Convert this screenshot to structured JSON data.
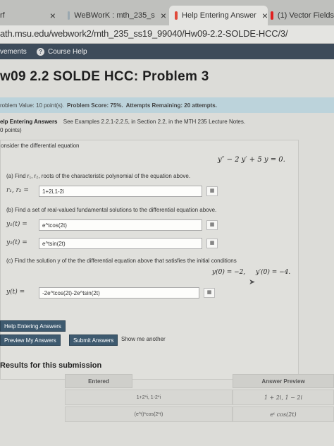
{
  "browser": {
    "tabs": [
      {
        "label": "rf",
        "close": "×"
      },
      {
        "label": "WeBWorK : mth_235_s",
        "close": "×"
      },
      {
        "label": "Help Entering Answer",
        "close": "×"
      },
      {
        "label": "(1) Vector Fields"
      }
    ],
    "url": "ath.msu.edu/webwork2/mth_235_ss19_99040/Hw09-2.2-SOLDE-HCC/3/"
  },
  "nav": {
    "items": [
      "vements",
      "Course Help"
    ]
  },
  "page": {
    "title": "w09 2.2 SOLDE HCC: Problem 3",
    "info": {
      "problem_value": "roblem Value: 10 point(s).",
      "problem_score": "Problem Score: 75%.",
      "attempts": "Attempts Remaining: 20 attempts."
    },
    "help_heading": "elp Entering Answers",
    "help_text": "See Examples 2.2.1-2.2.5, in Section 2.2, in the MTH 235 Lecture Notes.",
    "points": "0 points)"
  },
  "problem": {
    "intro": "onsider the differential equation",
    "equation": "y″ − 2 y′ + 5 y = 0.",
    "part_a": "(a) Find r₁, r₂, roots of the characteristic polynomial of the equation above.",
    "part_a_label": "r₁, r₂ =",
    "part_a_value": "1+2i,1-2i",
    "part_b": "(b) Find a set of real-valued fundamental solutions to the differential equation above.",
    "y1_label": "y₁(t) =",
    "y1_value": "e^tcos(2t)",
    "y2_label": "y₂(t) =",
    "y2_value": "e^tsin(2t)",
    "part_c": "(c) Find the solution y of the the differential equation above that satisfies the initial conditions",
    "ic1": "y(0) = −2,",
    "ic2": "y′(0) = −4.",
    "yt_label": "y(t) =",
    "yt_value": "-2e^tcos(2t)-2e^tsin(2t)",
    "grid_icon": "▦"
  },
  "buttons": {
    "help_entering": "Help Entering Answers",
    "preview": "Preview My Answers",
    "submit": "Submit Answers",
    "show_me": "Show me another"
  },
  "results": {
    "title": "Results for this submission",
    "headers": [
      "Entered",
      "Answer Preview"
    ],
    "rows": [
      [
        "1+2*i, 1-2*i",
        "1 + 2i, 1 − 2i"
      ],
      [
        "(e^t)*cos(2*t)",
        "eᵗ cos(2t)"
      ]
    ]
  },
  "colors": {
    "nav_bg": "#3d4b5a",
    "info_bg": "#bcd3db",
    "button_bg": "#3e5a6f"
  }
}
